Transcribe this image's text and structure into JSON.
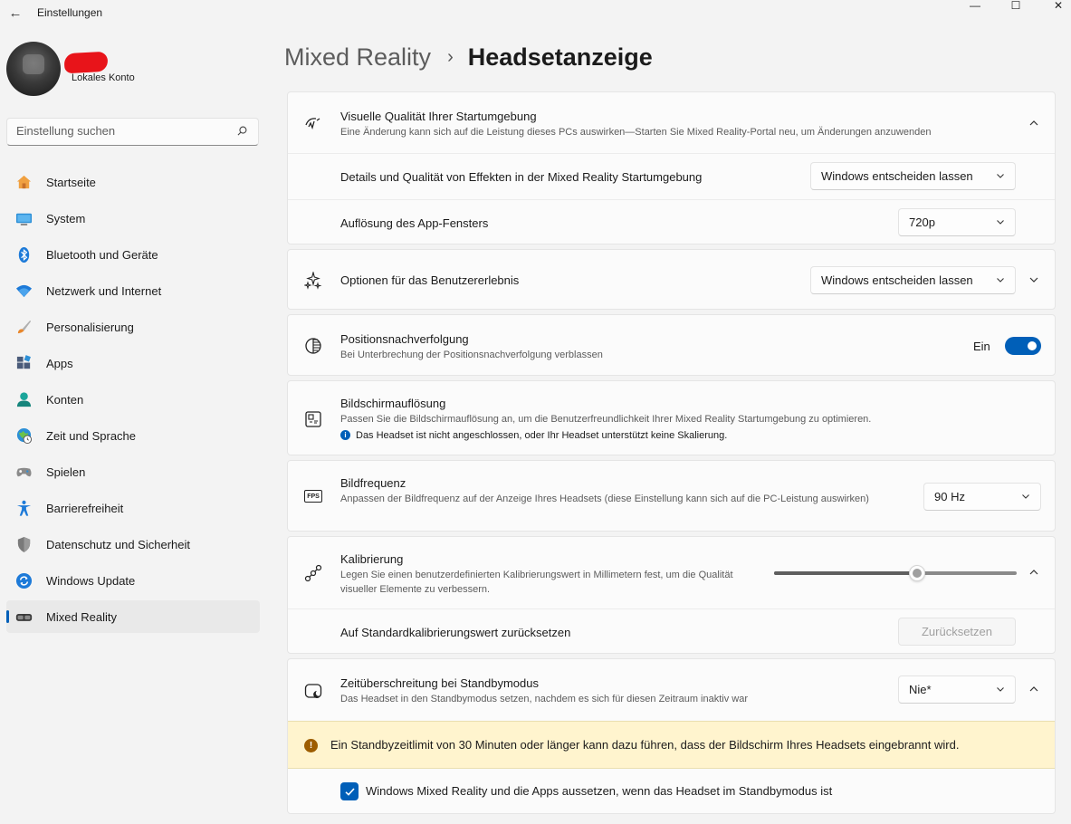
{
  "window": {
    "title": "Einstellungen",
    "minimize_glyph": "—",
    "maximize_glyph": "☐",
    "close_glyph": "✕",
    "back_glyph": "←"
  },
  "profile": {
    "account_type": "Lokales Konto"
  },
  "search": {
    "placeholder": "Einstellung suchen"
  },
  "sidebar": {
    "items": [
      {
        "label": "Startseite",
        "icon": "home-icon"
      },
      {
        "label": "System",
        "icon": "system-icon"
      },
      {
        "label": "Bluetooth und Geräte",
        "icon": "bluetooth-icon"
      },
      {
        "label": "Netzwerk und Internet",
        "icon": "wifi-icon"
      },
      {
        "label": "Personalisierung",
        "icon": "brush-icon"
      },
      {
        "label": "Apps",
        "icon": "apps-icon"
      },
      {
        "label": "Konten",
        "icon": "account-icon"
      },
      {
        "label": "Zeit und Sprache",
        "icon": "globe-clock-icon"
      },
      {
        "label": "Spielen",
        "icon": "gamepad-icon"
      },
      {
        "label": "Barrierefreiheit",
        "icon": "accessibility-icon"
      },
      {
        "label": "Datenschutz und Sicherheit",
        "icon": "shield-icon"
      },
      {
        "label": "Windows Update",
        "icon": "update-icon"
      },
      {
        "label": "Mixed Reality",
        "icon": "headset-icon",
        "active": true
      }
    ]
  },
  "header": {
    "parent": "Mixed Reality",
    "separator": "›",
    "current": "Headsetanzeige"
  },
  "visual_quality": {
    "title": "Visuelle Qualität Ihrer Startumgebung",
    "description": "Eine Änderung kann sich auf die Leistung dieses PCs auswirken—Starten Sie Mixed Reality-Portal neu, um Änderungen anzuwenden",
    "effects_label": "Details und Qualität von Effekten in der Mixed Reality Startumgebung",
    "effects_value": "Windows entscheiden lassen",
    "resolution_label": "Auflösung des App-Fensters",
    "resolution_value": "720p"
  },
  "user_experience": {
    "title": "Optionen für das Benutzererlebnis",
    "value": "Windows entscheiden lassen"
  },
  "tracking": {
    "title": "Positionsnachverfolgung",
    "description": "Bei Unterbrechung der Positionsnachverfolgung verblassen",
    "state_label": "Ein",
    "enabled": true
  },
  "display_resolution": {
    "title": "Bildschirmauflösung",
    "description": "Passen Sie die Bildschirmauflösung an, um die Benutzerfreundlichkeit Ihrer Mixed Reality Startumgebung zu optimieren.",
    "info": "Das Headset ist nicht angeschlossen, oder Ihr Headset unterstützt keine Skalierung."
  },
  "frame_rate": {
    "title": "Bildfrequenz",
    "description": "Anpassen der Bildfrequenz auf der Anzeige Ihres Headsets (diese Einstellung kann sich auf die PC-Leistung auswirken)",
    "value": "90 Hz",
    "icon_text": "FPS"
  },
  "calibration": {
    "title": "Kalibrierung",
    "description": "Legen Sie einen benutzerdefinierten Kalibrierungswert in Millimetern fest, um die Qualität visueller Elemente zu verbessern.",
    "slider_fraction": 0.59,
    "reset_label": "Auf Standardkalibrierungswert zurücksetzen",
    "reset_button": "Zurücksetzen"
  },
  "standby": {
    "title": "Zeitüberschreitung bei Standbymodus",
    "description": "Das Headset in den Standbymodus setzen, nachdem es sich für diesen Zeitraum inaktiv war",
    "value": "Nie*",
    "warning": "Ein Standbyzeitlimit von 30 Minuten oder länger kann dazu führen, dass der Bildschirm Ihres Headsets eingebrannt wird.",
    "suspend_label": "Windows Mixed Reality und die Apps aussetzen, wenn das Headset im Standbymodus ist",
    "suspend_checked": true
  },
  "colors": {
    "accent": "#005fb8",
    "warning_bg": "#fff4ce",
    "warning_icon": "#9d5d00",
    "background": "#f3f3f3",
    "card": "#fbfbfb"
  }
}
